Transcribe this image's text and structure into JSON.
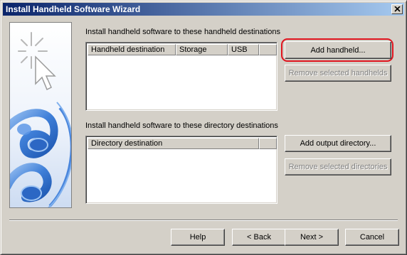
{
  "window": {
    "title": "Install Handheld Software Wizard",
    "close_glyph": "✕"
  },
  "handheld_section": {
    "label": "Install handheld software to these handheld destinations",
    "columns": [
      "Handheld destination",
      "Storage",
      "USB",
      ""
    ],
    "rows": [],
    "add_button": "Add handheld...",
    "remove_button": "Remove selected handhelds",
    "remove_enabled": false
  },
  "directory_section": {
    "label": "Install handheld software to these directory destinations",
    "columns": [
      "Directory destination",
      ""
    ],
    "rows": [],
    "add_button": "Add output directory...",
    "remove_button": "Remove selected directories",
    "remove_enabled": false
  },
  "footer": {
    "help": "Help",
    "back": "< Back",
    "next": "Next >",
    "cancel": "Cancel"
  },
  "colors": {
    "dialog_face": "#d4d0c8",
    "title_start": "#0a246a",
    "title_end": "#a6caf0",
    "highlight": "#e0141e"
  },
  "icons": {
    "close": "close-icon",
    "art": "handheld-cable-art"
  }
}
